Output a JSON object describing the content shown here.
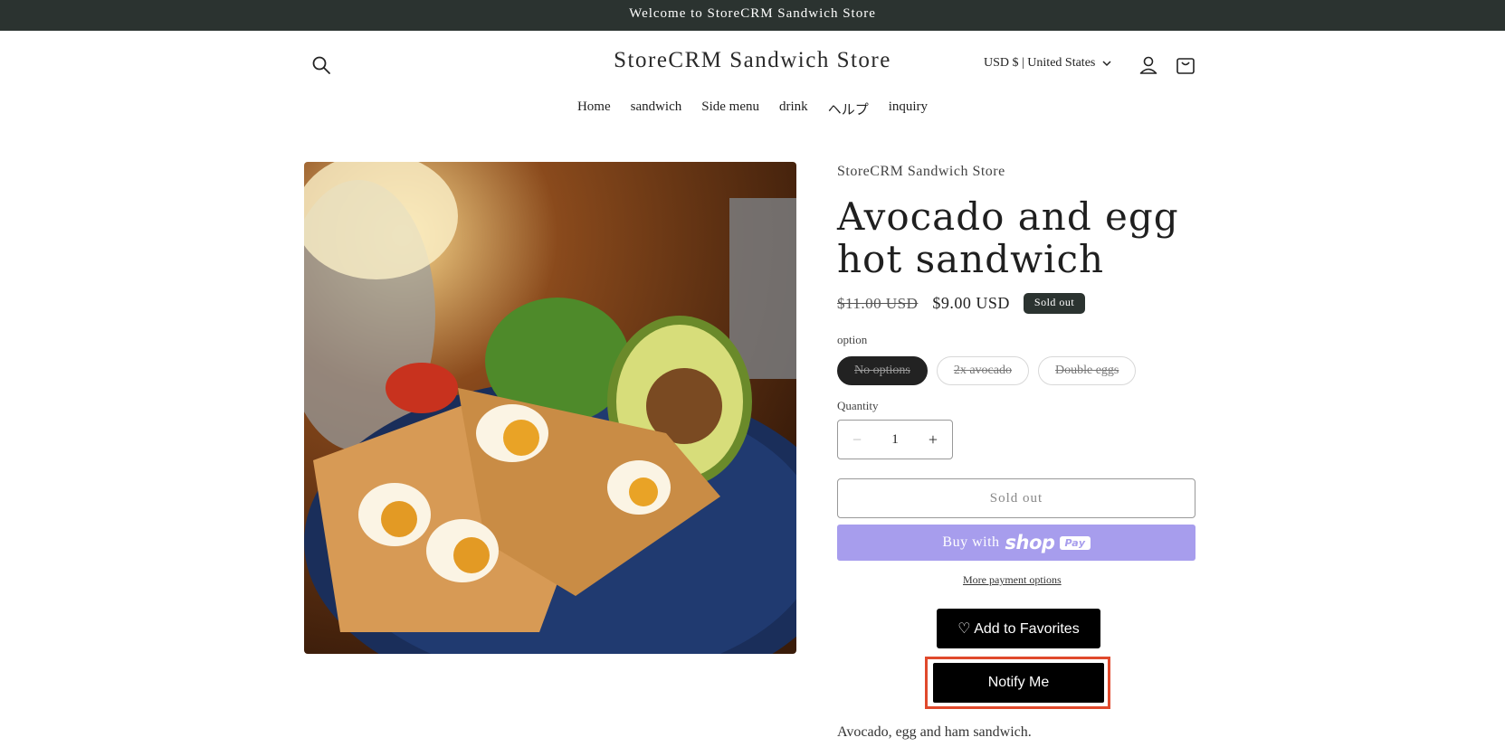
{
  "announcement": "Welcome to StoreCRM Sandwich Store",
  "header": {
    "store_title": "StoreCRM Sandwich Store",
    "currency_label": "USD $ | United States"
  },
  "nav": {
    "items": [
      "Home",
      "sandwich",
      "Side menu",
      "drink",
      "ヘルプ",
      "inquiry"
    ]
  },
  "product": {
    "vendor": "StoreCRM Sandwich Store",
    "title": "Avocado and egg hot sandwich",
    "price_old": "$11.00 USD",
    "price_new": "$9.00 USD",
    "badge": "Sold out",
    "option_label": "option",
    "options": [
      "No options",
      "2x avocado",
      "Double eggs"
    ],
    "quantity_label": "Quantity",
    "quantity": "1",
    "quantity_minus": "−",
    "quantity_plus": "+",
    "soldout_button": "Sold out",
    "buy_with": "Buy with",
    "shop_word": "shop",
    "pay_word": "Pay",
    "more_payment": "More payment options",
    "favorites_button": "♡ Add to Favorites",
    "notify_button": "Notify Me",
    "description": "Avocado, egg and ham sandwich."
  },
  "colors": {
    "announcement_bg": "#2b3330",
    "shop_pay": "#a79ded",
    "highlight": "#e0492c"
  }
}
